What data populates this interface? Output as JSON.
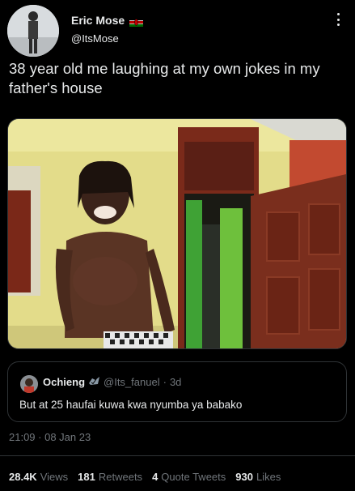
{
  "author": {
    "display_name": "Eric Mose",
    "handle": "@ItsMose"
  },
  "tweet": {
    "text": "38 year old me laughing at my own jokes in my father's house"
  },
  "quote_tweet": {
    "display_name": "Ochieng",
    "handle": "@Its_fanuel",
    "separator": "·",
    "age": "3d",
    "text": "But at 25 haufai kuwa kwa nyumba ya babako"
  },
  "timestamp": "21:09 · 08 Jan 23",
  "stats": {
    "views_value": "28.4K",
    "views_label": "Views",
    "retweets_value": "181",
    "retweets_label": "Retweets",
    "quotes_value": "4",
    "quotes_label": "Quote Tweets",
    "likes_value": "930",
    "likes_label": "Likes"
  },
  "icons": [
    "kenya-flag-icon",
    "more-options-icon",
    "verified-badge-icon"
  ],
  "colors": {
    "background": "#000000",
    "primary_text": "#e7e9ea",
    "secondary_text": "#71767b",
    "border": "#2f3336"
  }
}
